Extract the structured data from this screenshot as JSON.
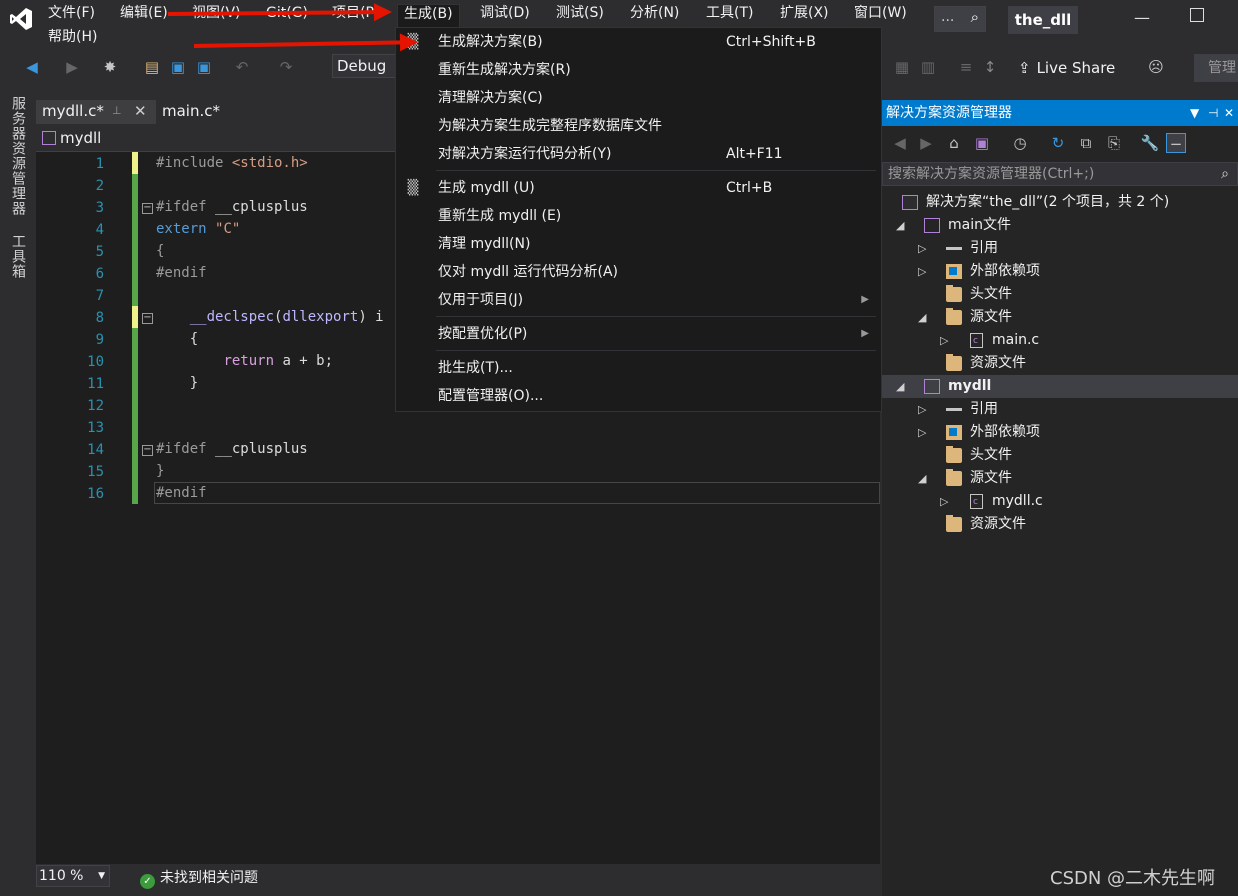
{
  "menubar": {
    "items": [
      "文件(F)",
      "编辑(E)",
      "视图(V)",
      "Git(G)",
      "项目(P)",
      "生成(B)",
      "调试(D)",
      "测试(S)",
      "分析(N)",
      "工具(T)",
      "扩展(X)",
      "窗口(W)"
    ],
    "second_row": "帮助(H)",
    "search_dots": "...",
    "project_name": "the_dll"
  },
  "toolbar": {
    "config": "Debug",
    "live_share": "Live Share",
    "manage": "管理"
  },
  "left_strip": {
    "server_explorer": "服务器资源管理器",
    "toolbox": "工具箱"
  },
  "tabs": [
    {
      "label": "mydll.c*"
    },
    {
      "label": "main.c*"
    }
  ],
  "nav": {
    "scope": "mydll"
  },
  "editor": {
    "line_numbers": [
      "1",
      "2",
      "3",
      "4",
      "5",
      "6",
      "7",
      "8",
      "9",
      "10",
      "11",
      "12",
      "13",
      "14",
      "15",
      "16"
    ]
  },
  "status": {
    "zoom": "110 %",
    "issues": "未找到相关问题"
  },
  "build_menu": {
    "items": [
      {
        "label": "生成解决方案(B)",
        "shortcut": "Ctrl+Shift+B"
      },
      {
        "label": "重新生成解决方案(R)",
        "shortcut": ""
      },
      {
        "label": "清理解决方案(C)",
        "shortcut": ""
      },
      {
        "label": "为解决方案生成完整程序数据库文件",
        "shortcut": ""
      },
      {
        "label": "对解决方案运行代码分析(Y)",
        "shortcut": "Alt+F11"
      },
      {
        "label": "生成 mydll (U)",
        "shortcut": "Ctrl+B"
      },
      {
        "label": "重新生成 mydll (E)",
        "shortcut": ""
      },
      {
        "label": "清理 mydll(N)",
        "shortcut": ""
      },
      {
        "label": "仅对 mydll 运行代码分析(A)",
        "shortcut": ""
      },
      {
        "label": "仅用于项目(J)",
        "shortcut": ""
      },
      {
        "label": "按配置优化(P)",
        "shortcut": ""
      },
      {
        "label": "批生成(T)...",
        "shortcut": ""
      },
      {
        "label": "配置管理器(O)...",
        "shortcut": ""
      }
    ]
  },
  "solution_explorer": {
    "title": "解决方案资源管理器",
    "search_placeholder": "搜索解决方案资源管理器(Ctrl+;)",
    "tree": [
      "解决方案“the_dll”(2 个项目，共 2 个)",
      "main文件",
      "引用",
      "外部依赖项",
      "头文件",
      "源文件",
      "main.c",
      "资源文件",
      "mydll",
      "引用",
      "外部依赖项",
      "头文件",
      "源文件",
      "mydll.c",
      "资源文件"
    ]
  },
  "watermark": "CSDN @二木先生啊"
}
